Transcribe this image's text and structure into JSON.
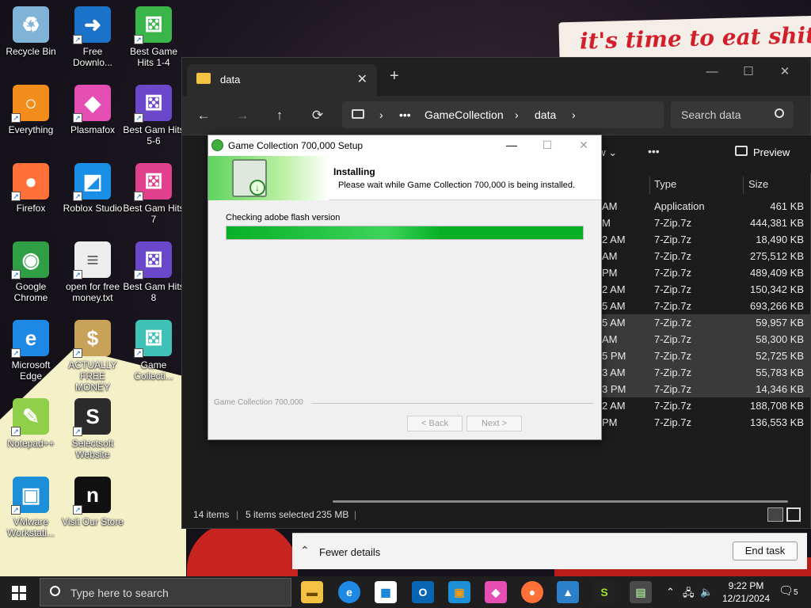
{
  "wallpaper": {
    "banner_text": "it's time to eat shit"
  },
  "desktop_icons": [
    {
      "label": "Recycle Bin",
      "icon": "recycle-bin-icon"
    },
    {
      "label": "Free Downlo...",
      "icon": "download-arrow-icon"
    },
    {
      "label": "Best Game Hits 1-4",
      "icon": "green-dice-icon"
    },
    {
      "label": "Everything",
      "icon": "magnifier-icon"
    },
    {
      "label": "Plasmafox",
      "icon": "plasmafox-icon"
    },
    {
      "label": "Best Gam Hits 5-6",
      "icon": "purple-dice-icon"
    },
    {
      "label": "Firefox",
      "icon": "firefox-icon"
    },
    {
      "label": "Roblox Studio",
      "icon": "roblox-studio-icon"
    },
    {
      "label": "Best Gam Hits 7",
      "icon": "pink-dice-icon"
    },
    {
      "label": "Google Chrome",
      "icon": "chrome-icon"
    },
    {
      "label": "open for free money.txt",
      "icon": "text-file-icon"
    },
    {
      "label": "Best Gam Hits 8",
      "icon": "purple-dice-icon"
    },
    {
      "label": "Microsoft Edge",
      "icon": "edge-icon"
    },
    {
      "label": "ACTUALLY FREE MONEY",
      "icon": "money-bag-icon"
    },
    {
      "label": "Game Collecti...",
      "icon": "teal-dice-icon"
    },
    {
      "label": "Notepad++",
      "icon": "notepadpp-icon"
    },
    {
      "label": "Selectsoft Website",
      "icon": "selectsoft-icon"
    },
    {
      "label": "VMware Workstati...",
      "icon": "vmware-icon"
    },
    {
      "label": "Visit Our Store",
      "icon": "store-icon"
    }
  ],
  "explorer": {
    "tab_title": "data",
    "nav": {
      "back": "←",
      "forward": "→",
      "up": "↑",
      "refresh": "⟳"
    },
    "breadcrumb": [
      "GameCollection",
      "data"
    ],
    "search_placeholder": "Search data",
    "toolbar": {
      "view_label": "ew",
      "more": "•••",
      "preview_label": "Preview"
    },
    "columns": {
      "type": "Type",
      "size": "Size"
    },
    "rows": [
      {
        "date": "AM",
        "type": "Application",
        "size": "461 KB",
        "selected": false
      },
      {
        "date": "M",
        "type": "7-Zip.7z",
        "size": "444,381 KB",
        "selected": false
      },
      {
        "date": "2 AM",
        "type": "7-Zip.7z",
        "size": "18,490 KB",
        "selected": false
      },
      {
        "date": "AM",
        "type": "7-Zip.7z",
        "size": "275,512 KB",
        "selected": false
      },
      {
        "date": "PM",
        "type": "7-Zip.7z",
        "size": "489,409 KB",
        "selected": false
      },
      {
        "date": "2 AM",
        "type": "7-Zip.7z",
        "size": "150,342 KB",
        "selected": false
      },
      {
        "date": "5 AM",
        "type": "7-Zip.7z",
        "size": "693,266 KB",
        "selected": false
      },
      {
        "date": "5 AM",
        "type": "7-Zip.7z",
        "size": "59,957 KB",
        "selected": true
      },
      {
        "date": "AM",
        "type": "7-Zip.7z",
        "size": "58,300 KB",
        "selected": true
      },
      {
        "date": "5 PM",
        "type": "7-Zip.7z",
        "size": "52,725 KB",
        "selected": true
      },
      {
        "date": "3 AM",
        "type": "7-Zip.7z",
        "size": "55,783 KB",
        "selected": true
      },
      {
        "date": "3 PM",
        "type": "7-Zip.7z",
        "size": "14,346 KB",
        "selected": true
      },
      {
        "date": "2 AM",
        "type": "7-Zip.7z",
        "size": "188,708 KB",
        "selected": false
      },
      {
        "date": "PM",
        "type": "7-Zip.7z",
        "size": "136,553 KB",
        "selected": false
      }
    ],
    "status": {
      "items": "14 items",
      "selected": "5 items selected",
      "size": "235 MB"
    }
  },
  "task_manager": {
    "fewer_details": "Fewer details",
    "end_task": "End task"
  },
  "setup": {
    "title": "Game Collection 700,000 Setup",
    "heading": "Installing",
    "subheading": "Please wait while Game Collection 700,000 is being installed.",
    "status": "Checking adobe flash version",
    "progress": 1.0,
    "brand": "Game Collection 700,000",
    "back_label": "< Back",
    "next_label": "Next >"
  },
  "taskbar": {
    "search_placeholder": "Type here to search",
    "time": "9:22 PM",
    "date": "12/21/2024",
    "notification_count": "5"
  }
}
